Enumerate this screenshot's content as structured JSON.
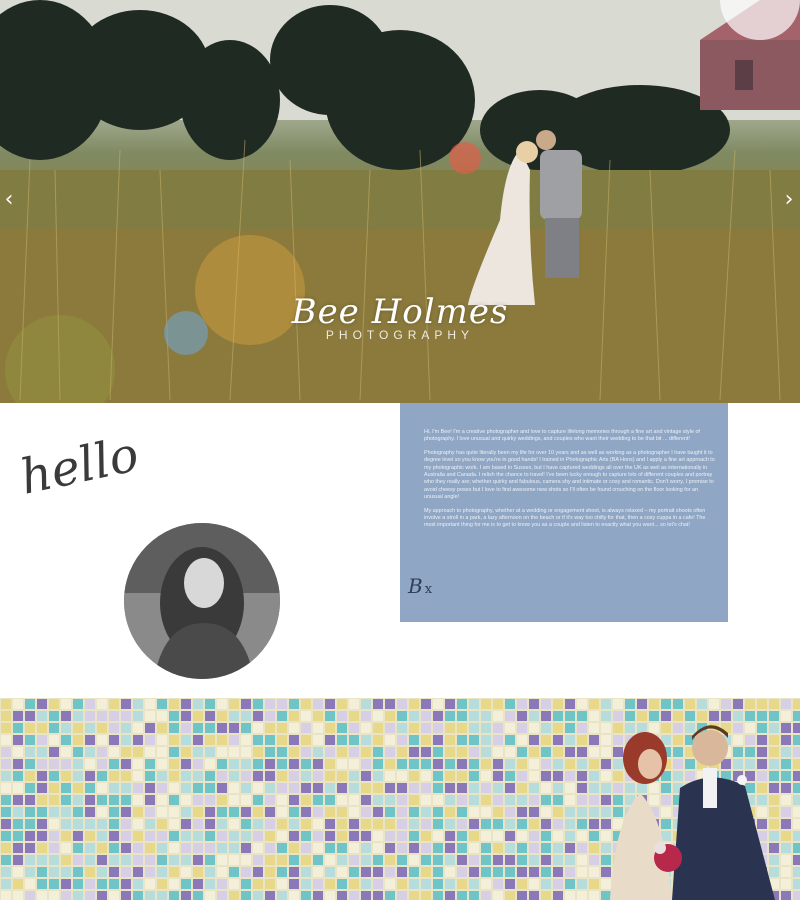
{
  "hero": {
    "logo_script": "Bee Holmes",
    "logo_sub": "PHOTOGRAPHY",
    "prev_icon": "chevron-left-icon",
    "next_icon": "chevron-right-icon",
    "prev_glyph": "‹",
    "next_glyph": "›"
  },
  "intro": {
    "hello": "hello",
    "bio_paragraphs": [
      "Hi, I'm Bee! I'm a creative photographer and love to capture lifelong memories through a fine art and vintage style of photography. I love unusual and quirky weddings, and couples who want their wedding to be that bit ... different!",
      "Photography has quite literally been my life for over 10 years and as well as working as a photographer I have taught it to degree level so you know you're in good hands! I trained in Photographic Arts (BA Hons) and I apply a fine art approach to my photographic work. I am based in Sussex, but I have captured weddings all over the UK as well as internationally in Australia and Canada. I relish the chance to travel! I've been lucky enough to capture lots of different couples and portray who they really are; whether quirky and fabulous, camera shy and intimate or cosy and romantic. Don't worry, I promise to avoid cheesy poses but I love to find awesome new shots so I'll often be found crouching on the floor looking for an unusual angle!",
      "My approach to photography, whether at a wedding or engagement shoot, is always relaxed – my portrait shoots often involve a stroll in a park, a lazy afternoon on the beach or if it's way too chilly for that, then a cosy cuppa in a cafe! The most important thing for me is to get to know you as a couple and listen to exactly what you want... so let's chat!"
    ],
    "sign_letter": "B",
    "sign_x": "x"
  },
  "colors": {
    "bio_bg": "#8fa6c4",
    "tile_teal": "#6fc4c8",
    "tile_purple": "#8a78b8",
    "tile_yellow": "#e8d98a"
  }
}
